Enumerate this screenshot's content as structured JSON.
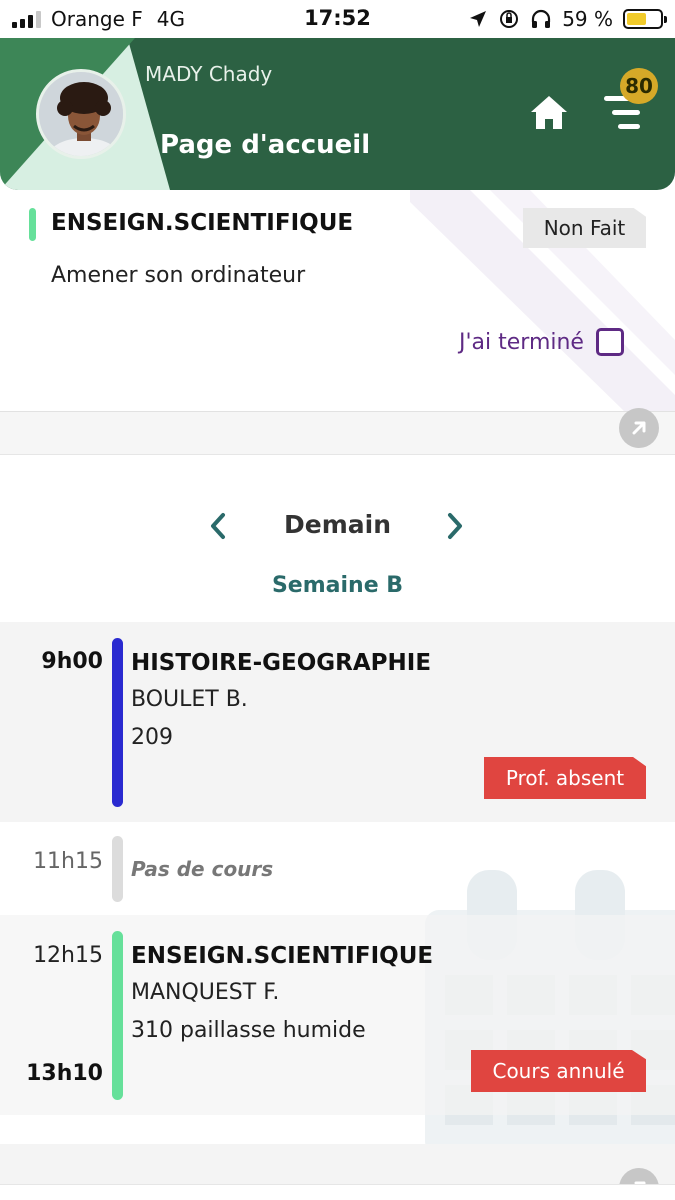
{
  "status_bar": {
    "carrier": "Orange F",
    "network": "4G",
    "time": "17:52",
    "battery": "59 %",
    "battery_level": 0.59
  },
  "header": {
    "user_name": "MADY Chady",
    "page_title": "Page d'accueil",
    "notification_count": "80",
    "home_icon": "home-icon",
    "menu_icon": "menu-icon"
  },
  "homework": {
    "subject": "ENSEIGN.SCIENTIFIQUE",
    "status": "Non Fait",
    "description": "Amener son ordinateur",
    "done_label": "J'ai terminé"
  },
  "schedule": {
    "day": "Demain",
    "week": "Semaine B",
    "lessons": [
      {
        "time": "9h00",
        "subject": "HISTOIRE-GEOGRAPHIE",
        "teacher": "BOULET B.",
        "room": "209",
        "tag": "Prof. absent"
      },
      {
        "time": "11h15",
        "label": "Pas de cours"
      },
      {
        "time": "12h15",
        "end_time": "13h10",
        "subject": "ENSEIGN.SCIENTIFIQUE",
        "teacher": "MANQUEST F.",
        "room": "310 paillasse humide",
        "tag": "Cours annulé"
      }
    ]
  },
  "colors": {
    "header_green": "#2c6143",
    "accent_purple": "#5e2a84",
    "tag_red": "#e04540",
    "lesson1_bar": "#2a2ad0",
    "lesson3_bar": "#66e09a",
    "badge_gold": "#d6a928"
  }
}
